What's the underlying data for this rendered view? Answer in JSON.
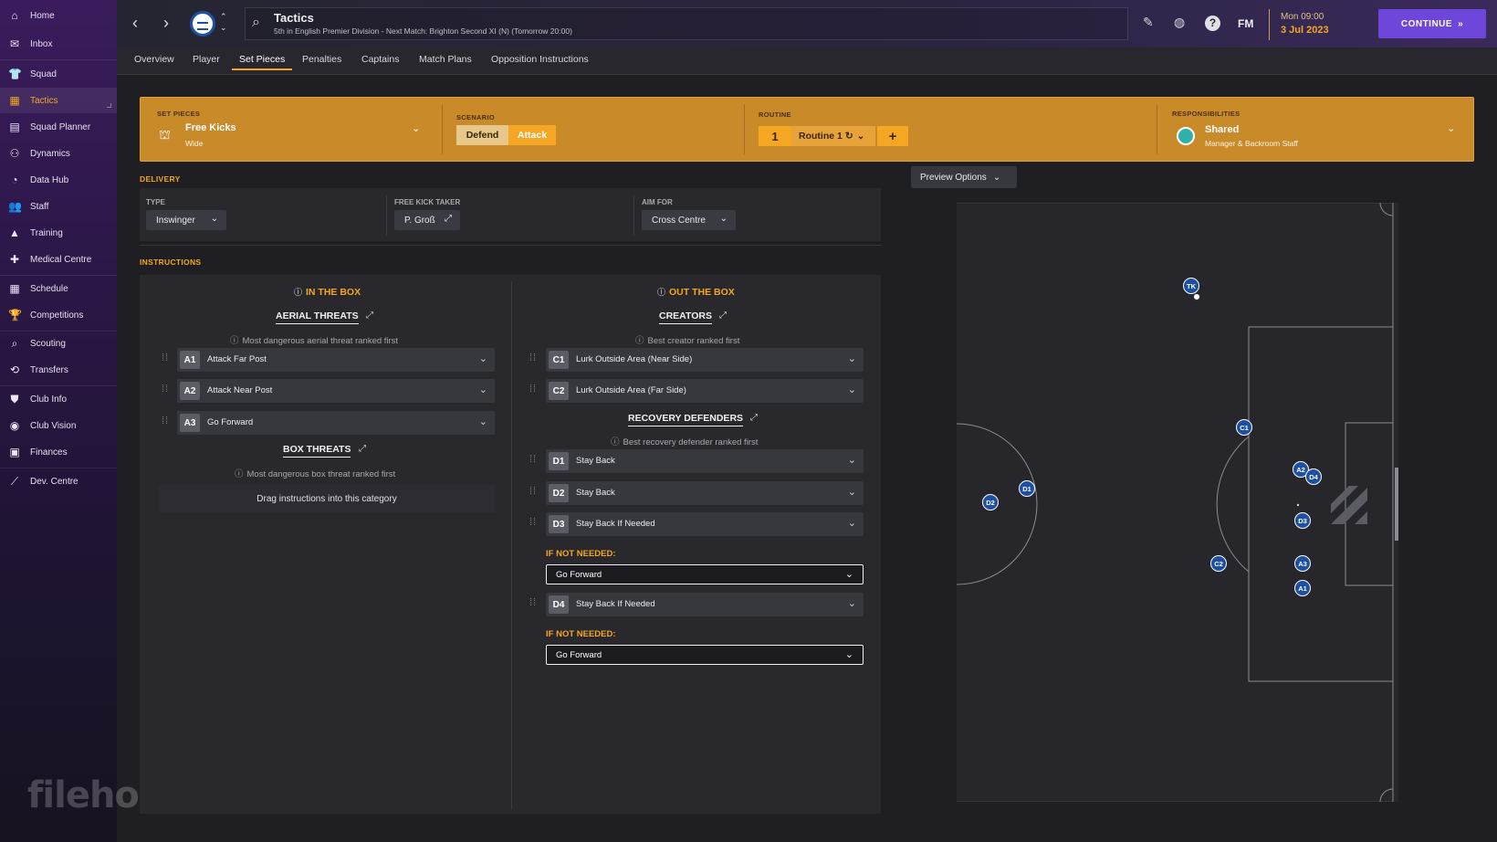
{
  "sidebar": {
    "items": [
      {
        "label": "Home",
        "icon": "home-icon",
        "glyph": "⌂"
      },
      {
        "label": "Inbox",
        "icon": "inbox-icon",
        "glyph": "✉"
      },
      {
        "label": "Squad",
        "icon": "squad-icon",
        "glyph": "👕"
      },
      {
        "label": "Tactics",
        "icon": "tactics-icon",
        "glyph": "▦"
      },
      {
        "label": "Squad Planner",
        "icon": "squad-planner-icon",
        "glyph": "▤"
      },
      {
        "label": "Dynamics",
        "icon": "dynamics-icon",
        "glyph": "⚇"
      },
      {
        "label": "Data Hub",
        "icon": "data-hub-icon",
        "glyph": "◔"
      },
      {
        "label": "Staff",
        "icon": "staff-icon",
        "glyph": "👥"
      },
      {
        "label": "Training",
        "icon": "training-icon",
        "glyph": "▲"
      },
      {
        "label": "Medical Centre",
        "icon": "medical-centre-icon",
        "glyph": "✚"
      },
      {
        "label": "Schedule",
        "icon": "schedule-icon",
        "glyph": "▦"
      },
      {
        "label": "Competitions",
        "icon": "competitions-icon",
        "glyph": "🏆"
      },
      {
        "label": "Scouting",
        "icon": "scouting-icon",
        "glyph": "⌕"
      },
      {
        "label": "Transfers",
        "icon": "transfers-icon",
        "glyph": "⟲"
      },
      {
        "label": "Club Info",
        "icon": "club-info-icon",
        "glyph": "⛊"
      },
      {
        "label": "Club Vision",
        "icon": "club-vision-icon",
        "glyph": "◉"
      },
      {
        "label": "Finances",
        "icon": "finances-icon",
        "glyph": "▣"
      },
      {
        "label": "Dev. Centre",
        "icon": "dev-centre-icon",
        "glyph": "⟋"
      }
    ],
    "active": "Tactics"
  },
  "header": {
    "title": "Tactics",
    "subtitle": "5th in English Premier Division - Next Match: Brighton Second XI (N) (Tomorrow 20:00)",
    "fm_label": "FM",
    "date_day": "Mon 09:00",
    "date_date": "3 Jul 2023",
    "continue_label": "CONTINUE"
  },
  "tabs": [
    "Overview",
    "Player",
    "Set Pieces",
    "Penalties",
    "Captains",
    "Match Plans",
    "Opposition Instructions"
  ],
  "active_tab": "Set Pieces",
  "setpieces": {
    "label": "SET PIECES",
    "value": "Free Kicks",
    "sub": "Wide",
    "scenario_label": "SCENARIO",
    "scenario_options": [
      "Defend",
      "Attack"
    ],
    "scenario_selected": "Attack",
    "routine_label": "ROUTINE",
    "routine_number": "1",
    "routine_name": "Routine 1",
    "responsibilities_label": "RESPONSIBILITIES",
    "responsibilities_value": "Shared",
    "responsibilities_sub": "Manager & Backroom Staff"
  },
  "delivery": {
    "label": "DELIVERY",
    "type_label": "TYPE",
    "type_value": "Inswinger",
    "taker_label": "FREE KICK TAKER",
    "taker_value": "P. Groß",
    "aim_label": "AIM FOR",
    "aim_value": "Cross Centre"
  },
  "instructions": {
    "label": "INSTRUCTIONS",
    "in_box": {
      "title": "IN THE BOX",
      "aerial_title": "AERIAL THREATS",
      "aerial_sub": "Most dangerous aerial threat ranked first",
      "aerial_rows": [
        {
          "tag": "A1",
          "text": "Attack Far Post"
        },
        {
          "tag": "A2",
          "text": "Attack Near Post"
        },
        {
          "tag": "A3",
          "text": "Go Forward"
        }
      ],
      "box_title": "BOX THREATS",
      "box_sub": "Most dangerous box threat ranked first",
      "box_empty": "Drag instructions into this category"
    },
    "out_box": {
      "title": "OUT THE BOX",
      "creators_title": "CREATORS",
      "creators_sub": "Best creator ranked first",
      "creator_rows": [
        {
          "tag": "C1",
          "text": "Lurk Outside Area (Near Side)"
        },
        {
          "tag": "C2",
          "text": "Lurk Outside Area (Far Side)"
        }
      ],
      "recovery_title": "RECOVERY DEFENDERS",
      "recovery_sub": "Best recovery defender ranked first",
      "recovery_rows": [
        {
          "tag": "D1",
          "text": "Stay Back"
        },
        {
          "tag": "D2",
          "text": "Stay Back"
        },
        {
          "tag": "D3",
          "text": "Stay Back If Needed"
        },
        {
          "tag": "D4",
          "text": "Stay Back If Needed"
        }
      ],
      "if_not_needed_label": "IF NOT NEEDED:",
      "d3_fallback": "Go Forward",
      "d4_fallback": "Go Forward"
    }
  },
  "preview_options_label": "Preview Options",
  "pitch_markers": [
    "TK",
    "C1",
    "A2",
    "D4",
    "D3",
    "A3",
    "A1",
    "C2",
    "D1",
    "D2"
  ],
  "watermark": "filehorse.com",
  "colors": {
    "accent": "#f5a623",
    "band": "#c98a2a",
    "continue": "#6e46d9",
    "marker": "#1d4fa3"
  }
}
